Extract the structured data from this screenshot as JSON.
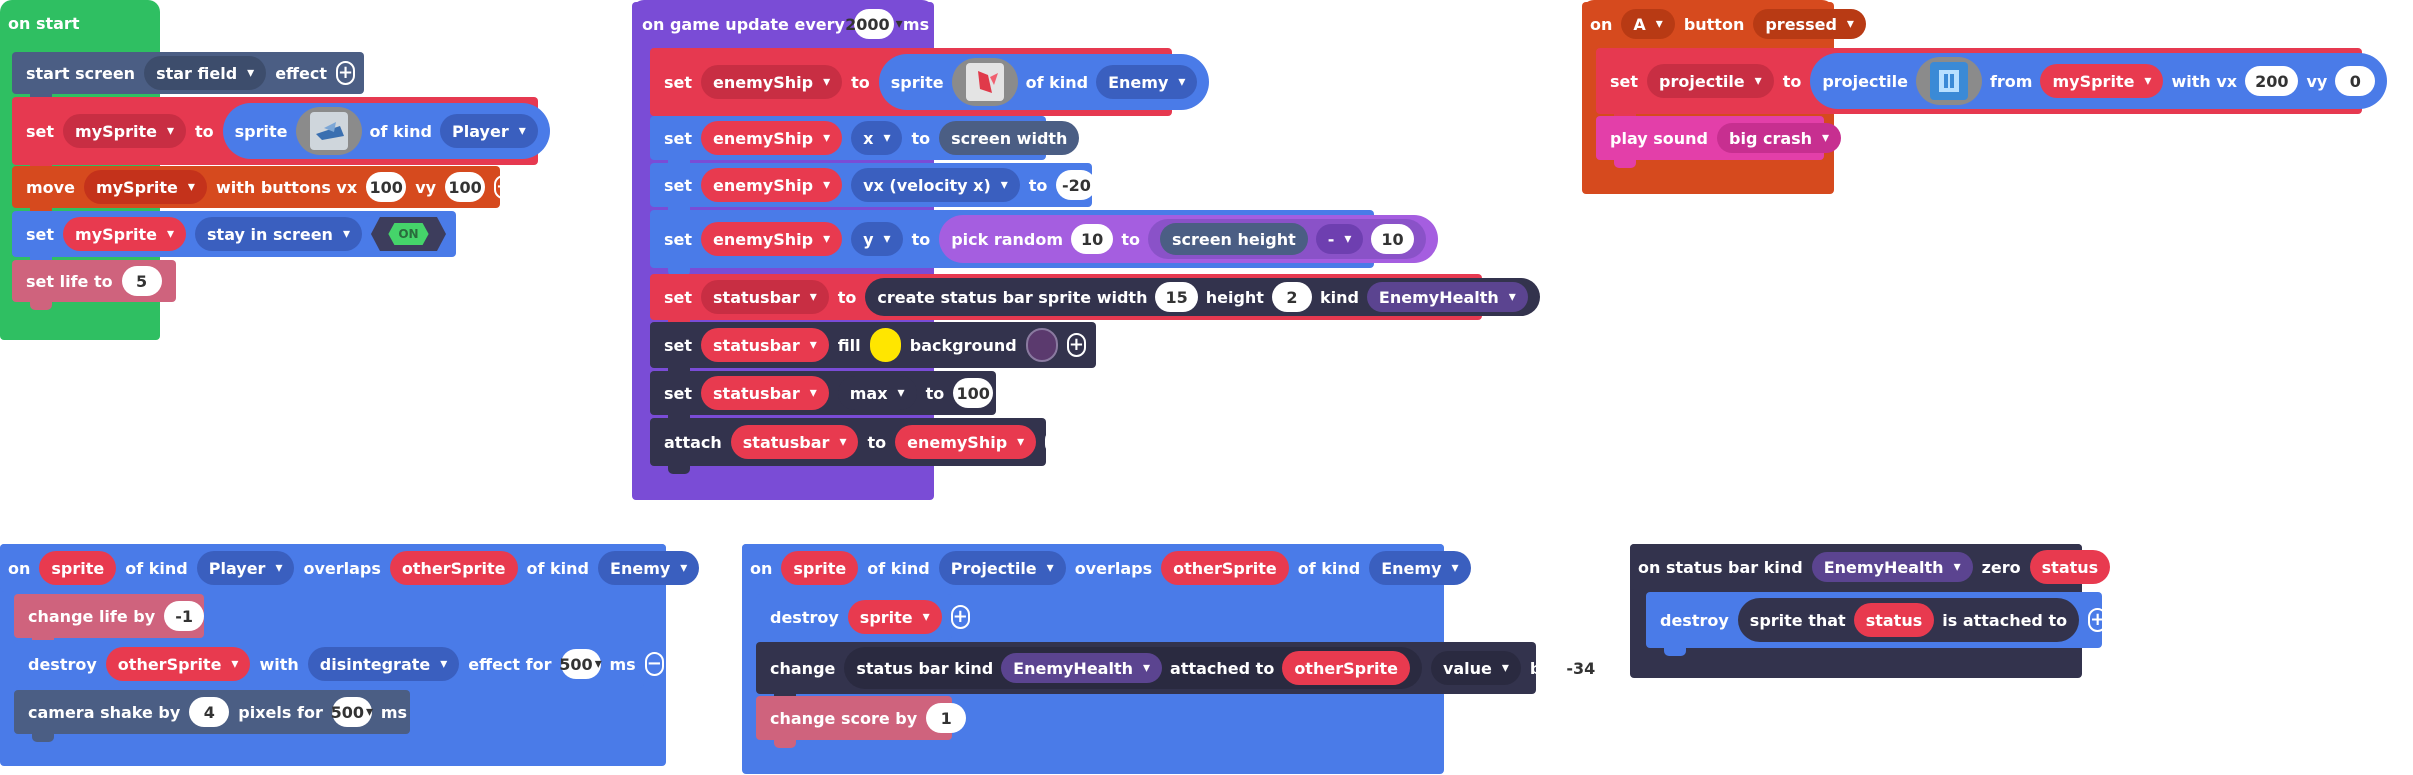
{
  "on_start": {
    "header": "on start",
    "start_screen": {
      "label": "start screen",
      "effect_value": "star field",
      "effect_label": "effect"
    },
    "set_player": {
      "set": "set",
      "var": "mySprite",
      "to": "to",
      "sprite": "sprite",
      "of_kind": "of kind",
      "kind": "Player"
    },
    "move": {
      "label": "move",
      "var": "mySprite",
      "with": "with buttons vx",
      "vx": "100",
      "vy_label": "vy",
      "vy": "100"
    },
    "stay": {
      "set": "set",
      "var": "mySprite",
      "prop": "stay in screen",
      "toggle": "ON"
    },
    "life": {
      "label": "set life to",
      "value": "5"
    }
  },
  "game_update": {
    "header": "on game update every",
    "interval": "2000",
    "unit": "ms",
    "set_enemy": {
      "set": "set",
      "var": "enemyShip",
      "to": "to",
      "sprite": "sprite",
      "of_kind": "of kind",
      "kind": "Enemy"
    },
    "set_x": {
      "set": "set",
      "var": "enemyShip",
      "prop": "x",
      "to": "to",
      "value": "screen width"
    },
    "set_vx": {
      "set": "set",
      "var": "enemyShip",
      "prop": "vx (velocity x)",
      "to": "to",
      "value": "-20"
    },
    "set_y": {
      "set": "set",
      "var": "enemyShip",
      "prop": "y",
      "to": "to",
      "pick": "pick random",
      "min": "10",
      "to2": "to",
      "height": "screen height",
      "op": "-",
      "sub": "10"
    },
    "set_status": {
      "set": "set",
      "var": "statusbar",
      "to": "to",
      "create": "create status bar sprite width",
      "width": "15",
      "height_label": "height",
      "height": "2",
      "kind_label": "kind",
      "kind": "EnemyHealth"
    },
    "fill": {
      "set": "set",
      "var": "statusbar",
      "fill": "fill",
      "background": "background",
      "fill_color": "#ffe600",
      "bg_color": "#5b3a6e"
    },
    "max": {
      "set": "set",
      "var": "statusbar",
      "prop": "max",
      "to": "to",
      "value": "100"
    },
    "attach": {
      "label": "attach",
      "var": "statusbar",
      "to": "to",
      "target": "enemyShip"
    }
  },
  "on_button": {
    "on": "on",
    "button": "A",
    "button_label": "button",
    "event": "pressed",
    "set_proj": {
      "set": "set",
      "var": "projectile",
      "to": "to",
      "projectile": "projectile",
      "from": "from",
      "source": "mySprite",
      "vx_label": "with vx",
      "vx": "200",
      "vy_label": "vy",
      "vy": "0"
    },
    "sound": {
      "label": "play sound",
      "value": "big crash"
    }
  },
  "overlap_player": {
    "on": "on",
    "sprite": "sprite",
    "of_kind": "of kind",
    "kind": "Player",
    "overlaps": "overlaps",
    "other": "otherSprite",
    "of_kind2": "of kind",
    "kind2": "Enemy",
    "change_life": {
      "label": "change life by",
      "value": "-1"
    },
    "destroy": {
      "label": "destroy",
      "var": "otherSprite",
      "with": "with",
      "effect": "disintegrate",
      "effect_for": "effect for",
      "ms_value": "500",
      "ms": "ms"
    },
    "shake": {
      "label": "camera shake by",
      "value": "4",
      "pixels_for": "pixels for",
      "ms_value": "500",
      "ms": "ms"
    }
  },
  "overlap_projectile": {
    "on": "on",
    "sprite": "sprite",
    "of_kind": "of kind",
    "kind": "Projectile",
    "overlaps": "overlaps",
    "other": "otherSprite",
    "of_kind2": "of kind",
    "kind2": "Enemy",
    "destroy": {
      "label": "destroy",
      "var": "sprite"
    },
    "change": {
      "label": "change",
      "status": "status bar kind",
      "kind": "EnemyHealth",
      "attached": "attached to",
      "target": "otherSprite",
      "prop": "value",
      "by": "by",
      "value": "-34"
    },
    "score": {
      "label": "change score by",
      "value": "1"
    }
  },
  "status_zero": {
    "header": "on status bar kind",
    "kind": "EnemyHealth",
    "zero": "zero",
    "status": "status",
    "destroy": {
      "label": "destroy",
      "sprite_that": "sprite that",
      "var": "status",
      "attached": "is attached to"
    }
  }
}
